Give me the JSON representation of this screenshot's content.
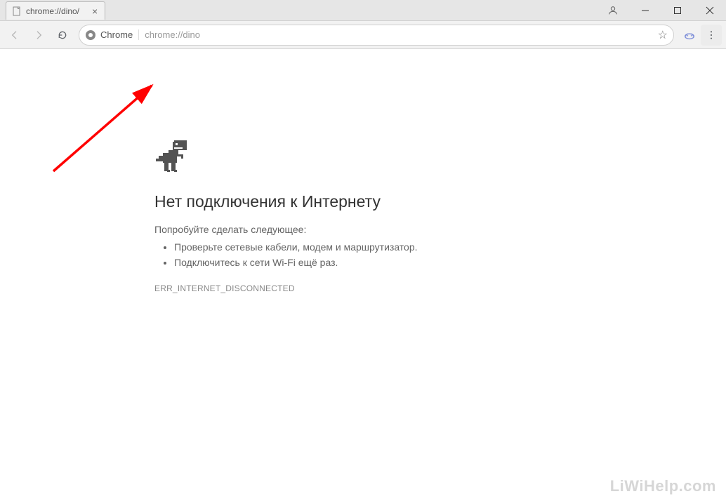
{
  "window": {
    "tab_title": "chrome://dino/"
  },
  "omnibox": {
    "origin_label": "Chrome",
    "url": "chrome://dino"
  },
  "error_page": {
    "heading": "Нет подключения к Интернету",
    "intro": "Попробуйте сделать следующее:",
    "suggestions": [
      "Проверьте сетевые кабели, модем и маршрутизатор.",
      "Подключитесь к сети Wi-Fi ещё раз."
    ],
    "error_code": "ERR_INTERNET_DISCONNECTED"
  },
  "watermark": "LiWiHelp.com"
}
